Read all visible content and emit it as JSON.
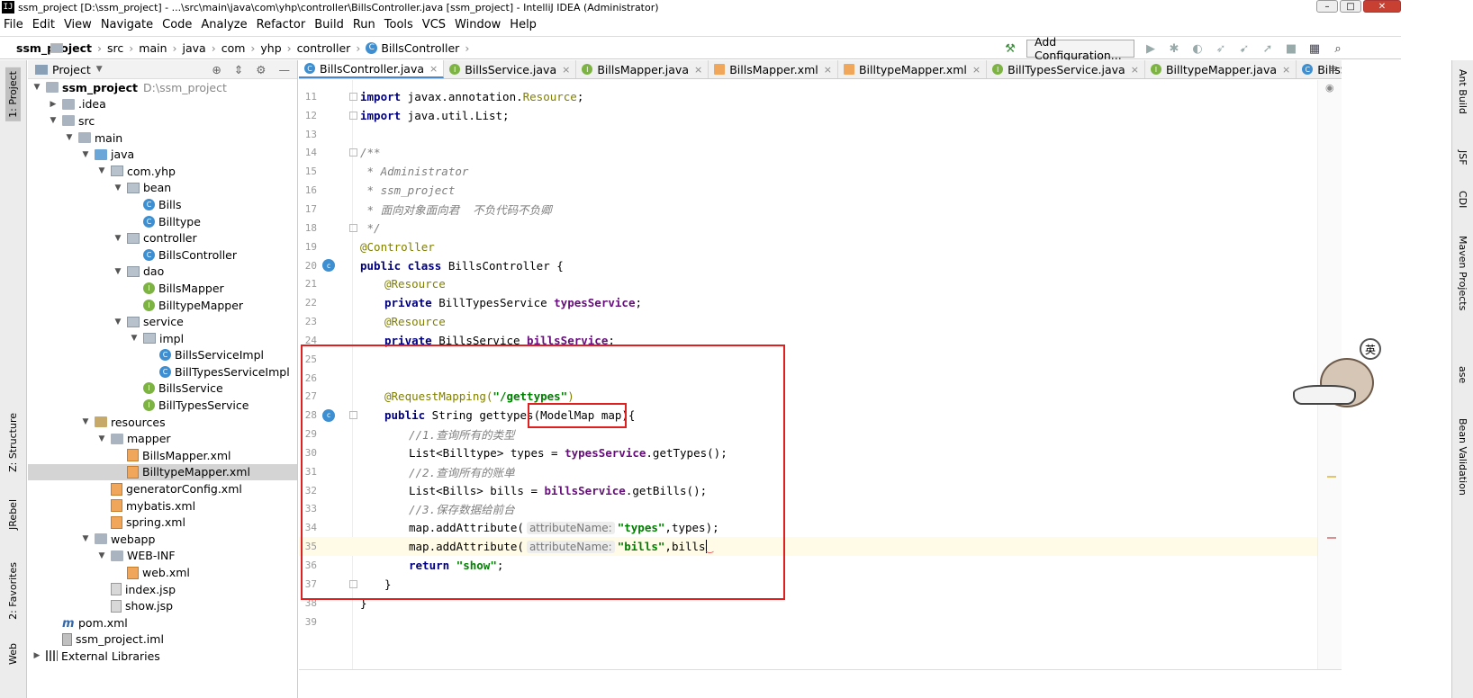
{
  "window": {
    "title": "ssm_project [D:\\ssm_project] - ...\\src\\main\\java\\com\\yhp\\controller\\BillsController.java [ssm_project] - IntelliJ IDEA (Administrator)",
    "app_icon": "IJ"
  },
  "menu": [
    "File",
    "Edit",
    "View",
    "Navigate",
    "Code",
    "Analyze",
    "Refactor",
    "Build",
    "Run",
    "Tools",
    "VCS",
    "Window",
    "Help"
  ],
  "breadcrumb": [
    "ssm_project",
    "src",
    "main",
    "java",
    "com",
    "yhp",
    "controller",
    "BillsController"
  ],
  "toolbar": {
    "add_config": "Add Configuration..."
  },
  "left_strip": {
    "project": "1: Project",
    "structure": "Z: Structure",
    "jrebel": "JRebel",
    "favorites": "2: Favorites",
    "web": "Web"
  },
  "right_strip": {
    "ant": "Ant Build",
    "jsf": "JSF",
    "cdi": "CDI",
    "maven": "Maven Projects",
    "database": "ase",
    "bean": "Bean Validation"
  },
  "project_panel": {
    "title": "Project",
    "tree": [
      {
        "label": "ssm_project",
        "extra": "D:\\ssm_project"
      },
      {
        "label": ".idea"
      },
      {
        "label": "src"
      },
      {
        "label": "main"
      },
      {
        "label": "java"
      },
      {
        "label": "com.yhp"
      },
      {
        "label": "bean"
      },
      {
        "label": "Bills"
      },
      {
        "label": "Billtype"
      },
      {
        "label": "controller"
      },
      {
        "label": "BillsController"
      },
      {
        "label": "dao"
      },
      {
        "label": "BillsMapper"
      },
      {
        "label": "BilltypeMapper"
      },
      {
        "label": "service"
      },
      {
        "label": "impl"
      },
      {
        "label": "BillsServiceImpl"
      },
      {
        "label": "BillTypesServiceImpl"
      },
      {
        "label": "BillsService"
      },
      {
        "label": "BillTypesService"
      },
      {
        "label": "resources"
      },
      {
        "label": "mapper"
      },
      {
        "label": "BillsMapper.xml"
      },
      {
        "label": "BilltypeMapper.xml"
      },
      {
        "label": "generatorConfig.xml"
      },
      {
        "label": "mybatis.xml"
      },
      {
        "label": "spring.xml"
      },
      {
        "label": "webapp"
      },
      {
        "label": "WEB-INF"
      },
      {
        "label": "web.xml"
      },
      {
        "label": "index.jsp"
      },
      {
        "label": "show.jsp"
      },
      {
        "label": "pom.xml"
      },
      {
        "label": "ssm_project.iml"
      },
      {
        "label": "External Libraries"
      }
    ]
  },
  "tabs": [
    "BillsController.java",
    "BillsService.java",
    "BillsMapper.java",
    "BillsMapper.xml",
    "BilltypeMapper.xml",
    "BillTypesService.java",
    "BilltypeMapper.java",
    "BillsServiceImpl.java"
  ],
  "editor": {
    "lines": [
      {
        "n": "11",
        "t": "import javax.annotation.Resource;"
      },
      {
        "n": "12",
        "t": "import java.util.List;"
      },
      {
        "n": "13",
        "t": ""
      },
      {
        "n": "14",
        "t": "/**"
      },
      {
        "n": "15",
        "t": " * Administrator"
      },
      {
        "n": "16",
        "t": " * ssm_project"
      },
      {
        "n": "17",
        "t": " * 面向对象面向君  不负代码不负卿"
      },
      {
        "n": "18",
        "t": " */"
      },
      {
        "n": "19",
        "t": "@Controller"
      },
      {
        "n": "20",
        "t": "public class BillsController {"
      },
      {
        "n": "21",
        "t": "@Resource"
      },
      {
        "n": "22",
        "t": "private BillTypesService typesService;"
      },
      {
        "n": "23",
        "t": "@Resource"
      },
      {
        "n": "24",
        "t": "private BillsService billsService;"
      },
      {
        "n": "25",
        "t": ""
      },
      {
        "n": "26",
        "t": ""
      },
      {
        "n": "27",
        "t": "@RequestMapping(\"/gettypes\")"
      },
      {
        "n": "28",
        "t": "public String gettypes(ModelMap map){"
      },
      {
        "n": "29",
        "t": "//1.查询所有的类型"
      },
      {
        "n": "30",
        "t": "List<Billtype> types = typesService.getTypes();"
      },
      {
        "n": "31",
        "t": "//2.查询所有的账单"
      },
      {
        "n": "32",
        "t": "List<Bills> bills = billsService.getBills();"
      },
      {
        "n": "33",
        "t": "//3.保存数据给前台"
      },
      {
        "n": "34",
        "t": "map.addAttribute(attributeName: \"types\",types);"
      },
      {
        "n": "35",
        "t": "map.addAttribute(attributeName: \"bills\",bills)"
      },
      {
        "n": "36",
        "t": "return \"show\";"
      },
      {
        "n": "37",
        "t": "}"
      },
      {
        "n": "38",
        "t": "}"
      },
      {
        "n": "39",
        "t": ""
      }
    ],
    "param_hint": "attributeName:"
  },
  "mascot": {
    "badge": "英"
  }
}
